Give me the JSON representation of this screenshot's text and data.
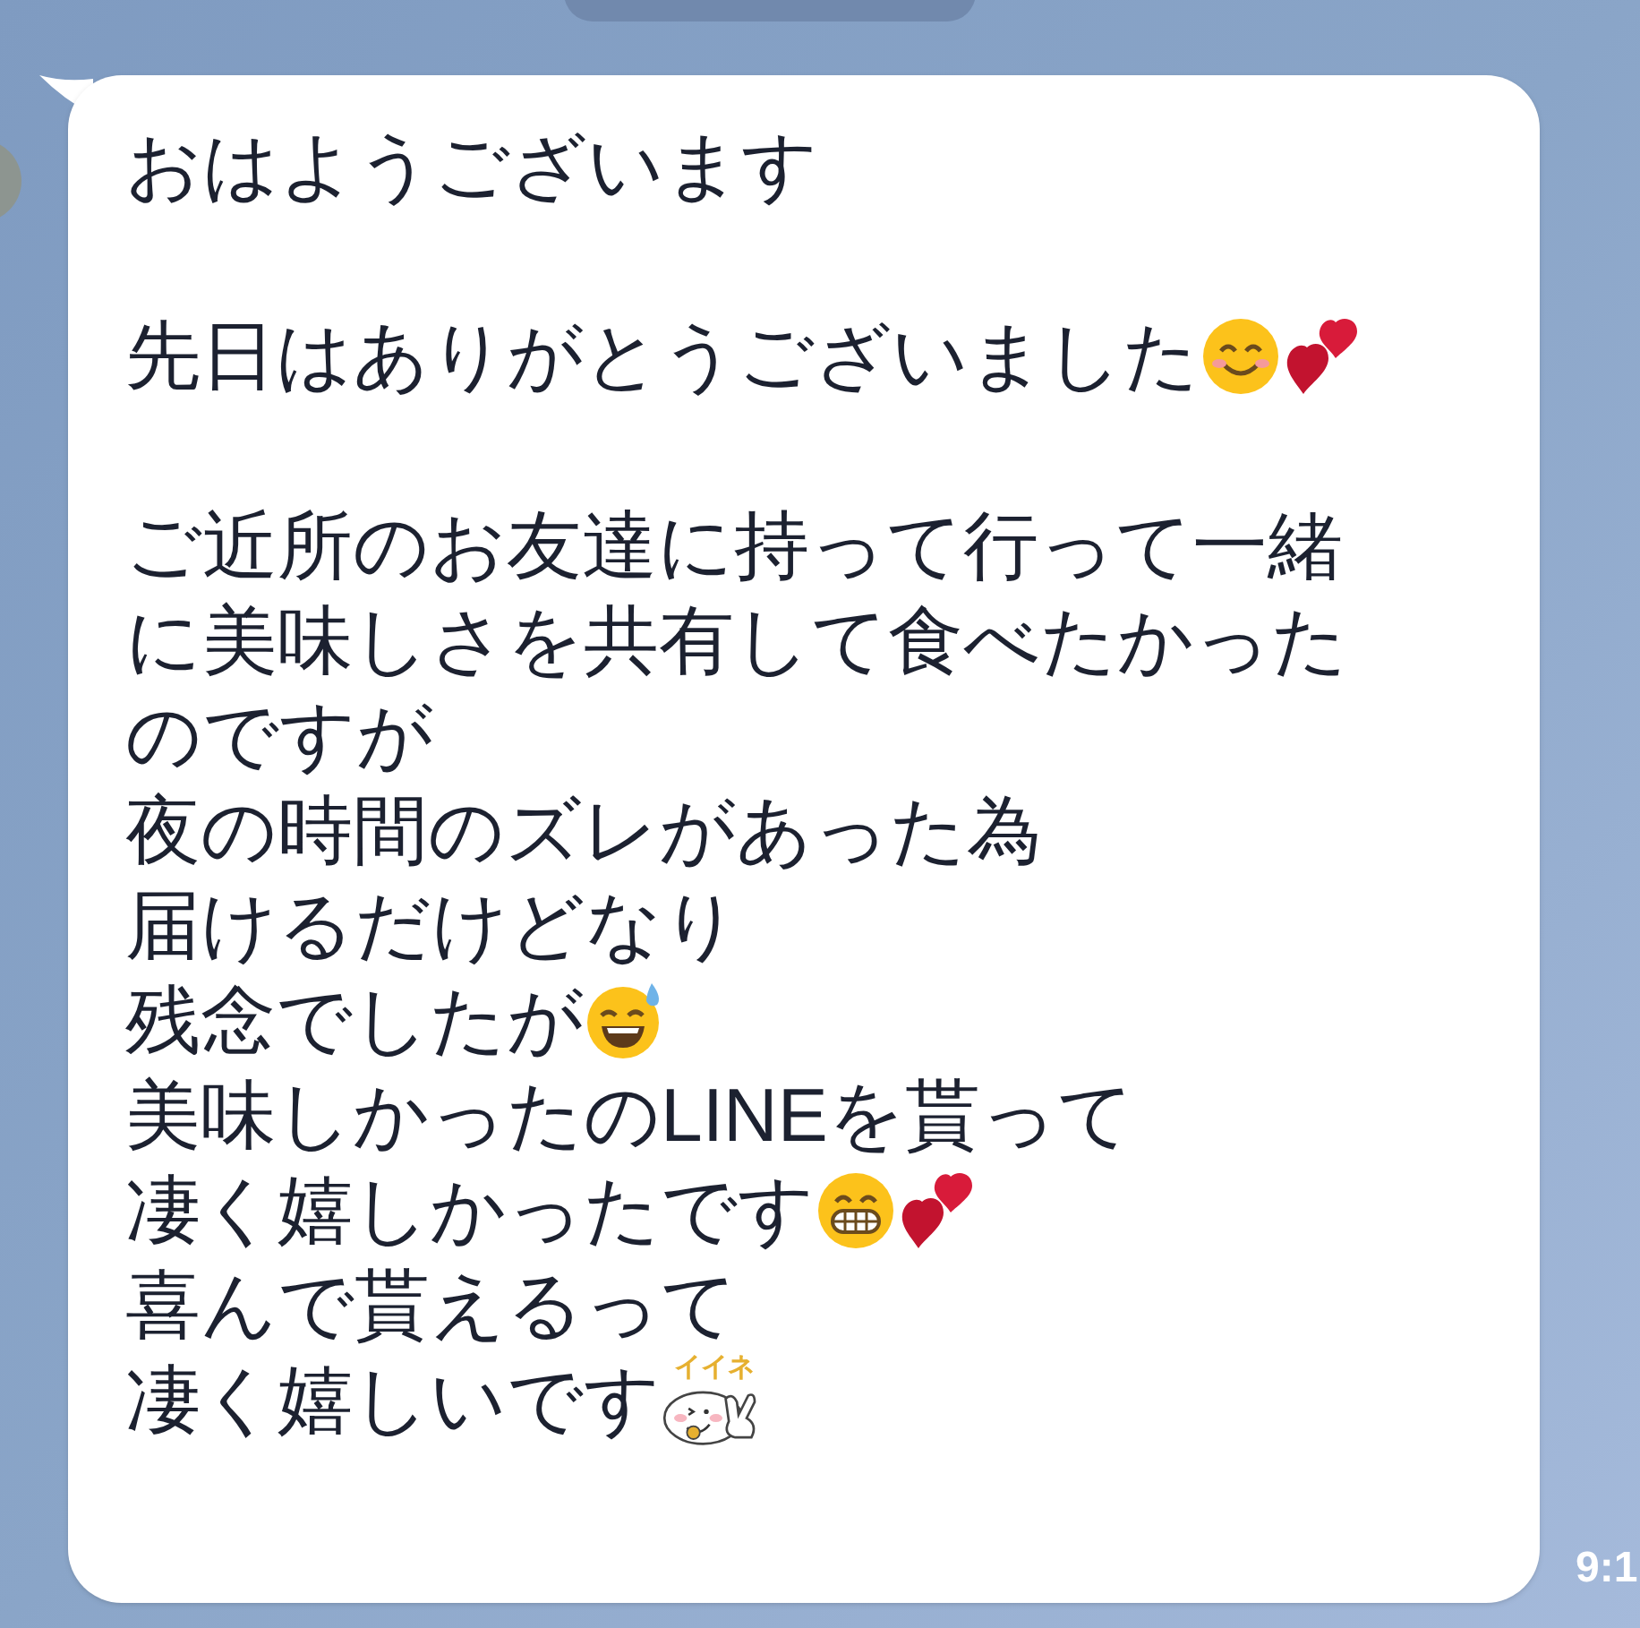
{
  "message": {
    "paragraphs": [
      [
        {
          "text": "おはようございます"
        }
      ],
      [
        {
          "text": "先日はありがとうございました",
          "emojis": [
            {
              "kind": "smile"
            },
            {
              "kind": "hearts"
            }
          ]
        }
      ],
      [
        {
          "text": "ご近所のお友達に持って行って一緒"
        },
        {
          "text": "に美味しさを共有して食べたかった"
        },
        {
          "text": "のですが"
        },
        {
          "text": "夜の時間のズレがあった為"
        },
        {
          "text": "届けるだけどなり"
        },
        {
          "text": "残念でしたが",
          "emojis": [
            {
              "kind": "sweat"
            }
          ]
        },
        {
          "text": "美味しかったのLINEを貰って"
        },
        {
          "text": "凄く嬉しかったです",
          "emojis": [
            {
              "kind": "grin"
            },
            {
              "kind": "hearts"
            }
          ]
        },
        {
          "text": "喜んで貰えるって"
        },
        {
          "text": "凄く嬉しいです",
          "emojis": [
            {
              "kind": "sticker",
              "label": "イイネ"
            }
          ]
        }
      ]
    ],
    "time": "9:1"
  }
}
